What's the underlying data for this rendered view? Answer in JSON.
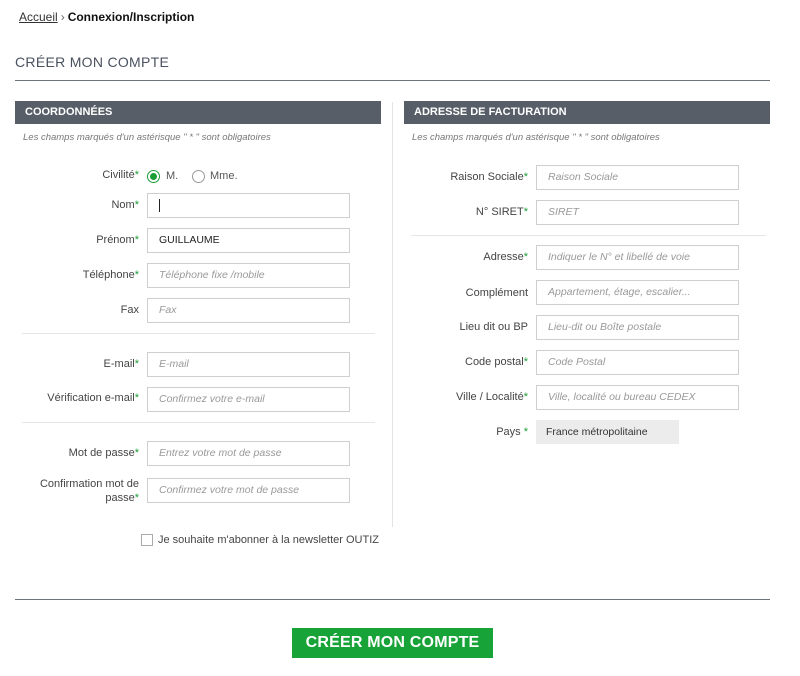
{
  "breadcrumb": {
    "home": "Accueil",
    "separator": "›",
    "current": "Connexion/Inscription"
  },
  "page": {
    "title": "CRÉER MON COMPTE"
  },
  "required_marker": "*",
  "left": {
    "header": "COORDONNÉES",
    "note": "Les champs marqués d'un astérisque \" * \" sont obligatoires",
    "civilite": {
      "label": "Civilité",
      "options": [
        "M.",
        "Mme."
      ],
      "selected": "M."
    },
    "nom": {
      "label": "Nom",
      "value": "",
      "placeholder": ""
    },
    "prenom": {
      "label": "Prénom",
      "value": "GUILLAUME"
    },
    "telephone": {
      "label": "Téléphone",
      "placeholder": "Téléphone fixe /mobile"
    },
    "fax": {
      "label": "Fax",
      "placeholder": "Fax"
    },
    "email": {
      "label": "E-mail",
      "placeholder": "E-mail"
    },
    "email_verif": {
      "label": "Vérification e-mail",
      "placeholder": "Confirmez votre e-mail"
    },
    "password": {
      "label": "Mot de passe",
      "placeholder": "Entrez votre mot de passe"
    },
    "password_confirm": {
      "label_line1": "Confirmation mot de",
      "label_line2": "passe",
      "placeholder": "Confirmez votre mot de passe"
    }
  },
  "right": {
    "header": "ADRESSE DE FACTURATION",
    "note": "Les champs marqués d'un astérisque \" * \" sont obligatoires",
    "raison_sociale": {
      "label": "Raison Sociale",
      "placeholder": "Raison Sociale"
    },
    "siret": {
      "label": "N° SIRET",
      "placeholder": "SIRET"
    },
    "adresse": {
      "label": "Adresse",
      "placeholder": "Indiquer le N° et libellé de voie"
    },
    "complement": {
      "label": "Complément",
      "placeholder": "Appartement, étage, escalier..."
    },
    "lieu_dit": {
      "label": "Lieu dit ou BP",
      "placeholder": "Lieu-dit ou Boîte postale"
    },
    "code_postal": {
      "label": "Code postal",
      "placeholder": "Code Postal"
    },
    "ville": {
      "label": "Ville / Localité",
      "placeholder": "Ville, localité ou bureau CEDEX"
    },
    "pays": {
      "label": "Pays",
      "value": "France métropolitaine"
    }
  },
  "newsletter": {
    "label": "Je souhaite m'abonner à la newsletter OUTIZ",
    "checked": false
  },
  "submit": {
    "label": "CRÉER MON COMPTE"
  },
  "colors": {
    "accent_green": "#18a338",
    "header_gray": "#575e67"
  }
}
